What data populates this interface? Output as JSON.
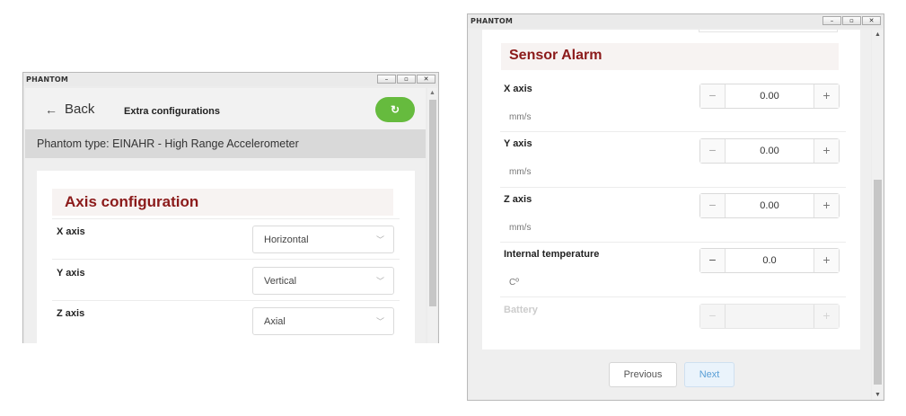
{
  "window1": {
    "title": "PHANTOM",
    "controls": {
      "minimize": "–",
      "maximize": "▫",
      "close": "✕"
    },
    "back_label": "Back",
    "page_title": "Extra configurations",
    "phantom_type": "Phantom type: EINAHR - High Range Accelerometer",
    "section_title": "Axis configuration",
    "axes": [
      {
        "label": "X axis",
        "value": "Horizontal"
      },
      {
        "label": "Y axis",
        "value": "Vertical"
      },
      {
        "label": "Z axis",
        "value": "Axial"
      }
    ],
    "colors": {
      "refresh_button": "#66bb3e",
      "section_title": "#8b1a1a"
    }
  },
  "window2": {
    "title": "PHANTOM",
    "controls": {
      "minimize": "–",
      "maximize": "▫",
      "close": "✕"
    },
    "section_title": "Sensor Alarm",
    "fields": [
      {
        "label": "X axis",
        "unit": "mm/s",
        "value": "0.00"
      },
      {
        "label": "Y axis",
        "unit": "mm/s",
        "value": "0.00"
      },
      {
        "label": "Z axis",
        "unit": "mm/s",
        "value": "0.00"
      },
      {
        "label": "Internal temperature",
        "unit": "Cº",
        "value": "0.0"
      },
      {
        "label": "Battery",
        "unit": "",
        "value": ""
      }
    ],
    "previous_label": "Previous",
    "next_label": "Next",
    "colors": {
      "next_button_text": "#5a9fd6"
    }
  }
}
